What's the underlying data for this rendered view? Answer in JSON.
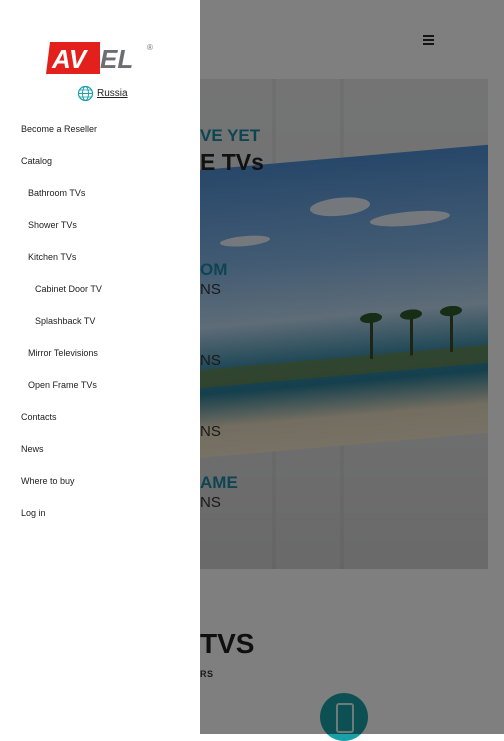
{
  "drawer": {
    "brand": "AVEL",
    "region_label": "Russia",
    "menu": [
      {
        "label": "Become a Reseller"
      },
      {
        "label": "Catalog"
      },
      {
        "label": "Bathroom TVs"
      },
      {
        "label": "Shower TVs"
      },
      {
        "label": "Kitchen TVs"
      },
      {
        "label": "Cabinet Door TV"
      },
      {
        "label": "Splashback TV"
      },
      {
        "label": "Mirror Televisions"
      },
      {
        "label": "Open Frame TVs"
      },
      {
        "label": "Contacts"
      },
      {
        "label": "News"
      },
      {
        "label": "Where to buy"
      },
      {
        "label": "Log in"
      }
    ]
  },
  "hero": {
    "line1": "VE YET",
    "line2": "E TVs",
    "item1_a": "OM",
    "item1_b": "NS",
    "item2_b": "NS",
    "item3_b": "NS",
    "item4_a": "AME",
    "item4_b": "NS"
  },
  "section": {
    "title": "TVS",
    "subtitle": "RS"
  },
  "colors": {
    "brand_red": "#e3201b",
    "brand_gray": "#6d6e70",
    "accent_teal": "#1b8aa7",
    "overlay": "rgba(0,0,0,0.5)"
  },
  "icons": {
    "menu": "hamburger-icon",
    "region": "globe-icon"
  }
}
